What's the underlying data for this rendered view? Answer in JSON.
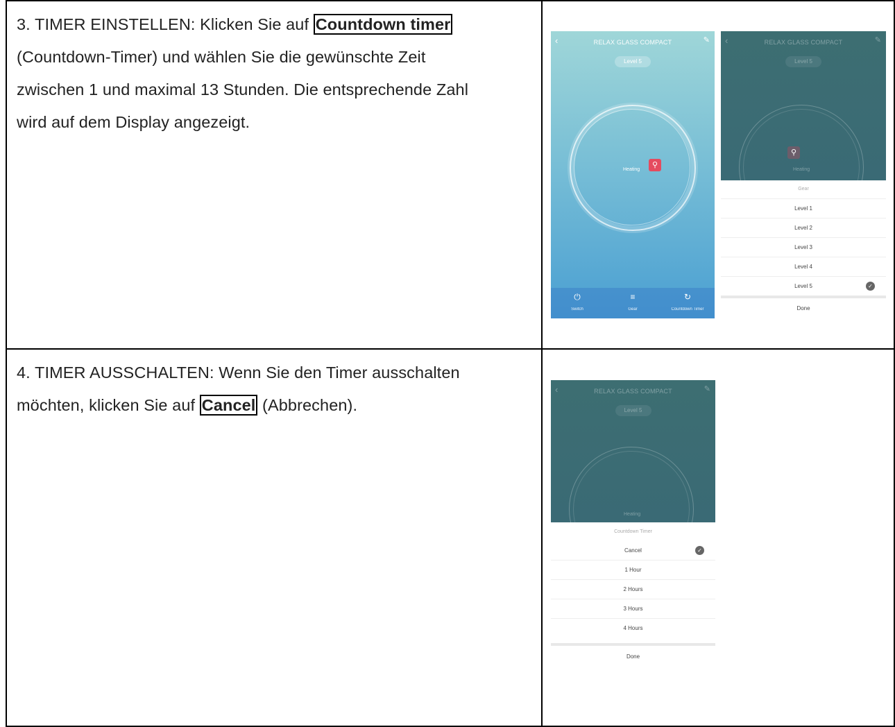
{
  "step3": {
    "line1_prefix": "3. TIMER EINSTELLEN: Klicken Sie auf ",
    "line1_button": "Countdown timer",
    "line2": "(Countdown-Timer) und wählen Sie die gewünschte Zeit",
    "line3": "zwischen 1 und maximal 13 Stunden. Die entsprechende Zahl",
    "line4": "wird auf dem Display angezeigt."
  },
  "step4": {
    "line1": "4. TIMER AUSSCHALTEN: Wenn Sie den Timer ausschalten",
    "line2_prefix": "möchten, klicken Sie auf ",
    "line2_button": "Cancel",
    "line2_suffix": " (Abbrechen)."
  },
  "app": {
    "title": "RELAX GLASS COMPACT",
    "level_pill": "Level 5",
    "heating": "Heating",
    "bottom": [
      {
        "icon": "power-icon",
        "label": "Switch"
      },
      {
        "icon": "gear-icon",
        "label": "Gear"
      },
      {
        "icon": "timer-icon",
        "label": "Countdown Timer"
      }
    ]
  },
  "gear_sheet": {
    "title": "Gear",
    "options": [
      "Level 1",
      "Level 2",
      "Level 3",
      "Level 4",
      "Level 5"
    ],
    "selected": "Level 5",
    "done": "Done"
  },
  "timer_sheet": {
    "title": "Countdown Timer",
    "options": [
      "Cancel",
      "1 Hour",
      "2 Hours",
      "3 Hours",
      "4 Hours"
    ],
    "selected": "Cancel",
    "done": "Done"
  },
  "colors": {
    "accent_red": "#e54b5f",
    "teal_top": "#9fd6d8",
    "blue_bottom": "#4a9fd2",
    "dark_overlay": "#3d6e72"
  }
}
